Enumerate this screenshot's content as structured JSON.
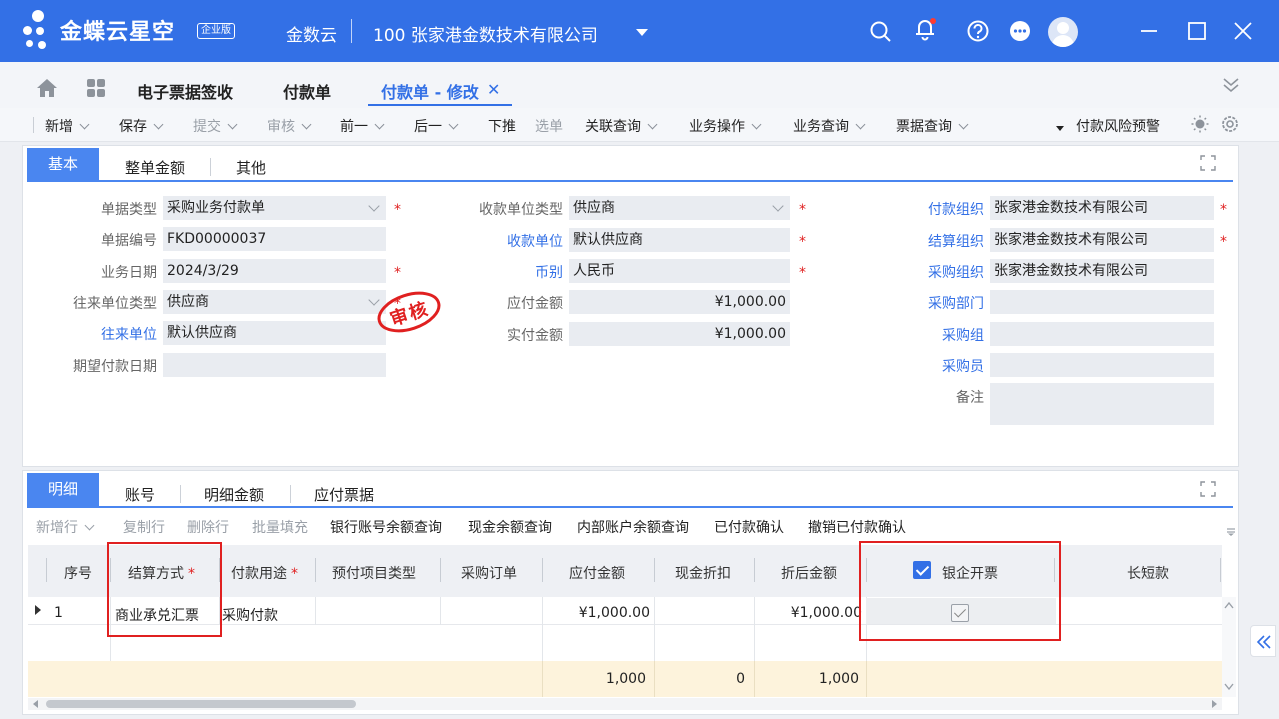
{
  "titlebar": {
    "brand": "金蝶云星空",
    "edition": "企业版",
    "product": "金数云",
    "company": "100  张家港金数技术有限公司"
  },
  "nav": {
    "tabs": [
      {
        "label": "电子票据签收"
      },
      {
        "label": "付款单"
      },
      {
        "label": "付款单 - 修改",
        "active": true
      }
    ]
  },
  "toolbar": {
    "items": [
      {
        "label": "新增",
        "dropdown": true,
        "disabled": false
      },
      {
        "label": "保存",
        "dropdown": true,
        "disabled": false
      },
      {
        "label": "提交",
        "dropdown": true,
        "disabled": true
      },
      {
        "label": "审核",
        "dropdown": true,
        "disabled": true
      },
      {
        "label": "前一",
        "dropdown": true,
        "disabled": false
      },
      {
        "label": "后一",
        "dropdown": true,
        "disabled": false
      },
      {
        "label": "下推",
        "dropdown": false,
        "disabled": false
      },
      {
        "label": "选单",
        "dropdown": false,
        "disabled": true
      },
      {
        "label": "关联查询",
        "dropdown": true,
        "disabled": false
      },
      {
        "label": "业务操作",
        "dropdown": true,
        "disabled": false
      },
      {
        "label": "业务查询",
        "dropdown": true,
        "disabled": false
      },
      {
        "label": "票据查询",
        "dropdown": true,
        "disabled": false
      }
    ],
    "risk_warning": "付款风险预警"
  },
  "header_tabs": [
    {
      "label": "基本",
      "active": true
    },
    {
      "label": "整单金额"
    },
    {
      "label": "其他"
    }
  ],
  "form": {
    "doc_type": {
      "label": "单据类型",
      "value": "采购业务付款单"
    },
    "doc_no": {
      "label": "单据编号",
      "value": "FKD00000037"
    },
    "biz_date": {
      "label": "业务日期",
      "value": "2024/3/29"
    },
    "partner_type": {
      "label": "往来单位类型",
      "value": "供应商"
    },
    "partner": {
      "label": "往来单位",
      "value": "默认供应商"
    },
    "expected_date": {
      "label": "期望付款日期",
      "value": ""
    },
    "payee_type": {
      "label": "收款单位类型",
      "value": "供应商"
    },
    "payee": {
      "label": "收款单位",
      "value": "默认供应商"
    },
    "currency": {
      "label": "币别",
      "value": "人民币"
    },
    "payable_amount": {
      "label": "应付金额",
      "value": "¥1,000.00"
    },
    "paid_amount": {
      "label": "实付金额",
      "value": "¥1,000.00"
    },
    "pay_org": {
      "label": "付款组织",
      "value": "张家港金数技术有限公司"
    },
    "settle_org": {
      "label": "结算组织",
      "value": "张家港金数技术有限公司"
    },
    "purchase_org": {
      "label": "采购组织",
      "value": "张家港金数技术有限公司"
    },
    "purchase_dept": {
      "label": "采购部门",
      "value": ""
    },
    "purchase_group": {
      "label": "采购组",
      "value": ""
    },
    "purchaser": {
      "label": "采购员",
      "value": ""
    },
    "remark": {
      "label": "备注",
      "value": ""
    },
    "stamp": "审核"
  },
  "detail_tabs": [
    {
      "label": "明细",
      "active": true
    },
    {
      "label": "账号"
    },
    {
      "label": "明细金额"
    },
    {
      "label": "应付票据"
    }
  ],
  "grid_toolbar": [
    {
      "label": "新增行",
      "disabled": true,
      "dropdown": true
    },
    {
      "label": "复制行",
      "disabled": true
    },
    {
      "label": "删除行",
      "disabled": true
    },
    {
      "label": "批量填充",
      "disabled": true
    },
    {
      "label": "银行账号余额查询",
      "disabled": false
    },
    {
      "label": "现金余额查询",
      "disabled": false
    },
    {
      "label": "内部账户余额查询",
      "disabled": false
    },
    {
      "label": "已付款确认",
      "disabled": false
    },
    {
      "label": "撤销已付款确认",
      "disabled": false
    }
  ],
  "grid": {
    "columns": [
      "序号",
      "结算方式",
      "付款用途",
      "预付项目类型",
      "采购订单",
      "应付金额",
      "现金折扣",
      "折后金额",
      "银企开票",
      "长短款"
    ],
    "rows": [
      {
        "seq": "1",
        "settle_method": "商业承兑汇票",
        "purpose": "采购付款",
        "prepay_type": "",
        "po": "",
        "payable": "¥1,000.00",
        "discount": "",
        "after_discount": "¥1,000.00",
        "bank_invoice": true,
        "over_short": ""
      }
    ],
    "totals": {
      "payable": "1,000",
      "discount": "0",
      "after_discount": "1,000"
    }
  },
  "colors": {
    "primary": "#3370e6",
    "highlight": "#e02020",
    "summary_bg": "#fdf3dc"
  }
}
